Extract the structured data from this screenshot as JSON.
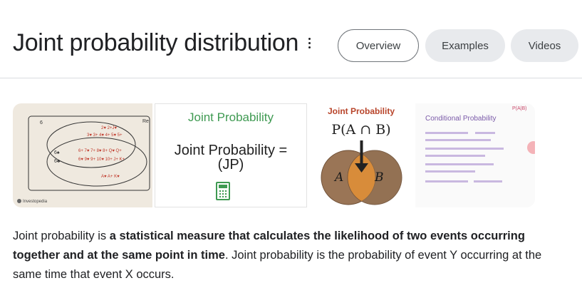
{
  "header": {
    "title": "Joint probability distribution",
    "more_icon": "more-vert-icon",
    "chips": [
      {
        "label": "Overview",
        "selected": true
      },
      {
        "label": "Examples",
        "selected": false
      },
      {
        "label": "Videos",
        "selected": false
      }
    ]
  },
  "images": [
    {
      "kind": "venn-cards",
      "left_labels": [
        "6",
        "6♠",
        "6♣"
      ],
      "top_right": "Re",
      "rows": [
        "2♥ 2+J♥",
        "3♥ 3+ 4♥ 4+ 5♥ 5+",
        "6+ 7♥ 7+ 8♥ 8+ Q♥ Q+",
        "6♥ 9♥ 9+ 10♥ 10+ J+ K+",
        "A♥ A+ K♥"
      ],
      "brand": "Investopedia"
    },
    {
      "kind": "definition",
      "title": "Joint Probability",
      "body_line1": "Joint Probability =",
      "body_line2": "(JP)",
      "icon": "calculator-icon"
    },
    {
      "kind": "venn-intersection",
      "title": "Joint Probability",
      "formula": "P(A ∩ B)",
      "set_a": "A",
      "set_b": "B"
    },
    {
      "kind": "conditional",
      "title": "Conditional Probability",
      "corner": "P(A|B)"
    }
  ],
  "answer": {
    "lead": "Joint probability is ",
    "bold": "a statistical measure that calculates the likelihood of two events occurring together and at the same point in time",
    "tail": ". Joint probability is the probability of event Y occurring at the same time that event X occurs."
  },
  "colors": {
    "chip_border": "#70757a",
    "chip_bg": "#e8eaed",
    "jp_green": "#3f9a52",
    "venn_brown": "#8a6645",
    "title_red": "#b8442a"
  }
}
